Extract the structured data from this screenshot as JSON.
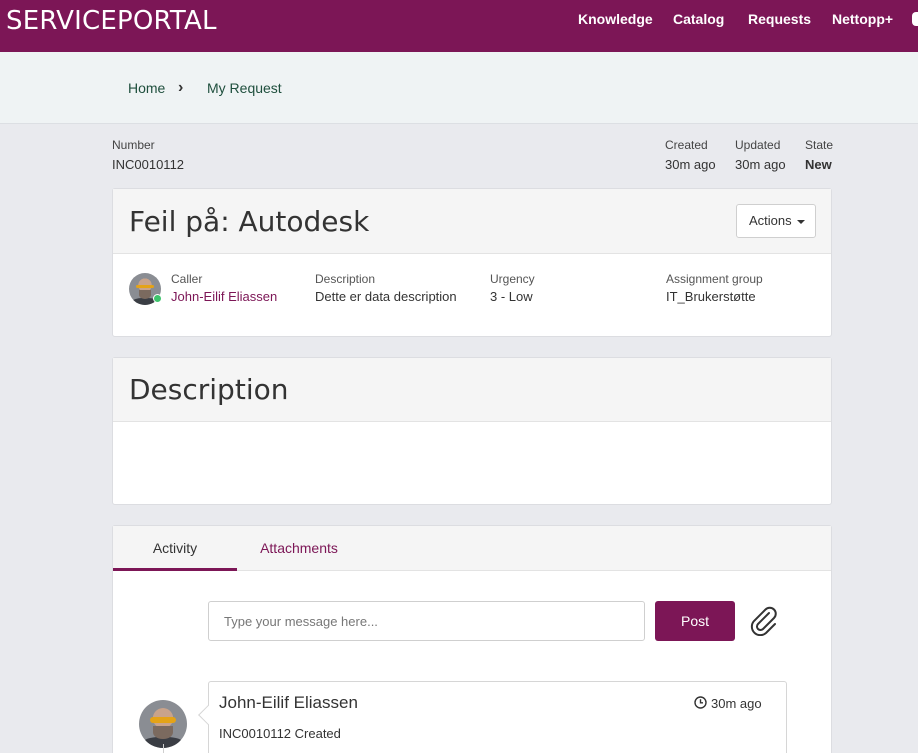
{
  "header": {
    "brand": "SERVICEPORTAL",
    "nav": [
      "Knowledge",
      "Catalog",
      "Requests",
      "Nettopp+"
    ]
  },
  "breadcrumb": {
    "home": "Home",
    "separator": "›",
    "current": "My Request"
  },
  "meta": {
    "number_label": "Number",
    "number_value": "INC0010112",
    "created_label": "Created",
    "created_value": "30m ago",
    "updated_label": "Updated",
    "updated_value": "30m ago",
    "state_label": "State",
    "state_value": "New"
  },
  "ticket": {
    "title": "Feil på: Autodesk",
    "actions_label": "Actions",
    "caller_label": "Caller",
    "caller_value": "John-Eilif Eliassen",
    "description_label": "Description",
    "description_value": "Dette er data description",
    "urgency_label": "Urgency",
    "urgency_value": "3 - Low",
    "group_label": "Assignment group",
    "group_value": "IT_Brukerstøtte"
  },
  "description_card": {
    "title": "Description"
  },
  "activity": {
    "tabs": [
      "Activity",
      "Attachments"
    ],
    "input_placeholder": "Type your message here...",
    "post_label": "Post",
    "entry": {
      "author": "John-Eilif Eliassen",
      "time": "30m ago",
      "text": "INC0010112 Created"
    }
  },
  "colors": {
    "brand": "#7c1656",
    "presence": "#3ec46d"
  }
}
